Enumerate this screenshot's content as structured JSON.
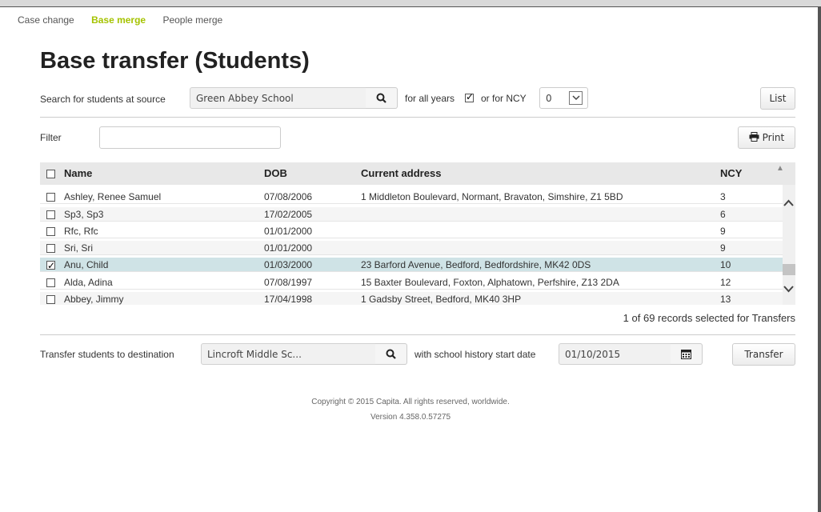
{
  "tabs": [
    {
      "label": "Case change",
      "active": false
    },
    {
      "label": "Base merge",
      "active": true
    },
    {
      "label": "People merge",
      "active": false
    }
  ],
  "page_title": "Base transfer (Students)",
  "search": {
    "label": "Search for students at source",
    "value": "Green Abbey School",
    "all_years_label": "for all years",
    "all_years_checked": true,
    "ncy_label": "or for NCY",
    "ncy_value": "0",
    "list_button": "List"
  },
  "filter": {
    "label": "Filter",
    "value": "",
    "print_button": "Print"
  },
  "table": {
    "columns": [
      "Name",
      "DOB",
      "Current address",
      "NCY"
    ],
    "rows": [
      {
        "name": "Ashley, Renee Samuel",
        "dob": "07/08/2006",
        "address": "1 Middleton Boulevard, Normant, Bravaton, Simshire, Z1 5BD",
        "ncy": "3",
        "checked": false
      },
      {
        "name": "Sp3, Sp3",
        "dob": "17/02/2005",
        "address": "",
        "ncy": "6",
        "checked": false
      },
      {
        "name": "Rfc, Rfc",
        "dob": "01/01/2000",
        "address": "",
        "ncy": "9",
        "checked": false
      },
      {
        "name": "Sri, Sri",
        "dob": "01/01/2000",
        "address": "",
        "ncy": "9",
        "checked": false
      },
      {
        "name": "Anu, Child",
        "dob": "01/03/2000",
        "address": "23 Barford Avenue, Bedford, Bedfordshire, MK42 0DS",
        "ncy": "10",
        "checked": true
      },
      {
        "name": "Alda, Adina",
        "dob": "07/08/1997",
        "address": "15 Baxter Boulevard, Foxton, Alphatown, Perfshire, Z13 2DA",
        "ncy": "12",
        "checked": false
      },
      {
        "name": "Abbey, Jimmy",
        "dob": "17/04/1998",
        "address": "1 Gadsby Street, Bedford, MK40 3HP",
        "ncy": "13",
        "checked": false
      }
    ]
  },
  "records_text": "1 of 69 records selected for Transfers",
  "transfer": {
    "label": "Transfer students to destination",
    "destination_value": "Lincroft Middle Sc...",
    "date_label": "with school history start date",
    "date_value": "01/10/2015",
    "button": "Transfer"
  },
  "footer": {
    "copyright": "Copyright © 2015 Capita. All rights reserved, worldwide.",
    "version": "Version 4.358.0.57275"
  }
}
